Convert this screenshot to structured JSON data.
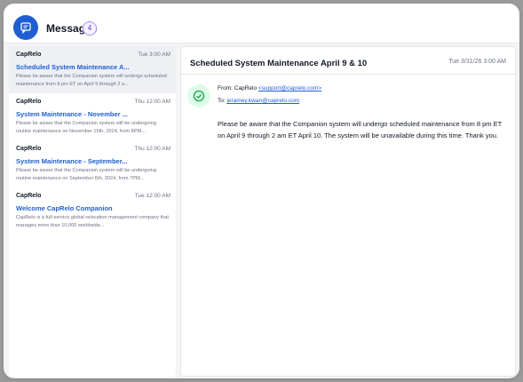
{
  "header": {
    "title": "Messages",
    "count": "4"
  },
  "messages": [
    {
      "sender": "CapRelo",
      "date": "Tue 3:00 AM",
      "subject": "Scheduled System Maintenance A...",
      "snippet": "Please be aware that the Companion system will undergo scheduled maintenance from 8 pm ET on April 9 through 2 a..."
    },
    {
      "sender": "CapRelo",
      "date": "Thu 12:00 AM",
      "subject": "System Maintenance - November ...",
      "snippet": "Please be aware that the Companion system will be undergoing routine maintenance on November 15th, 2024, from 8PM..."
    },
    {
      "sender": "CapRelo",
      "date": "Thu 12:00 AM",
      "subject": "System Maintenance - September...",
      "snippet": "Please be aware that the Companion system will be undergoing routine maintenance on September 6th, 2024, from 7PM..."
    },
    {
      "sender": "CapRelo",
      "date": "Tue 12:00 AM",
      "subject": "Welcome CapRelo Companion",
      "snippet": "CapRelo is a full-service global relocation management company that manages more than 10,000 worldwide..."
    }
  ],
  "detail": {
    "subject": "Scheduled System Maintenance April 9 & 10",
    "date": "Tue 3/31/26 3:00 AM",
    "from_label": "From: CapRelo",
    "from_email": "<support@caprelo.com>",
    "to_label": "To:",
    "to_email": "jeramey.kwan@caprelo.com",
    "body": "Please be aware that the Companion system will undergo scheduled maintenance from 8 pm ET on April 9 through 2 am ET April 10. The system will be unavailable during this time. Thank you."
  },
  "icons": {
    "app": "chat-bubble-icon",
    "status": "check-circle-icon"
  },
  "colors": {
    "accent": "#1f5fd1",
    "badge_border": "#a78bfa",
    "success": "#16a34a"
  }
}
